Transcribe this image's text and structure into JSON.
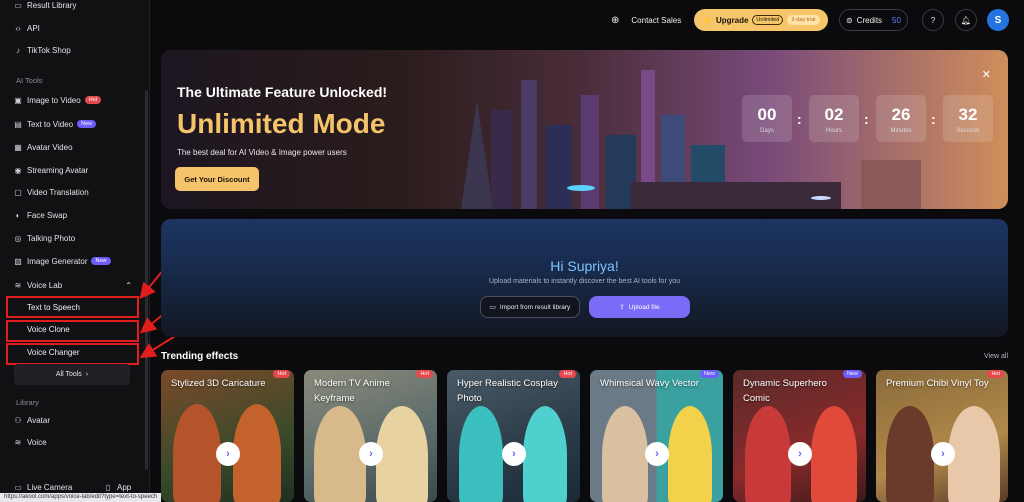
{
  "sidebar": {
    "top_items": [
      {
        "label": "Result Library",
        "icon": "folder-icon"
      },
      {
        "label": "API",
        "icon": "code-icon"
      },
      {
        "label": "TikTok Shop",
        "icon": "tiktok-icon"
      }
    ],
    "ai_tools_heading": "AI Tools",
    "ai_tools": [
      {
        "label": "Image to Video",
        "badge": "Hot"
      },
      {
        "label": "Text to Video",
        "badge": "New"
      },
      {
        "label": "Avatar Video",
        "badge": ""
      },
      {
        "label": "Streaming Avatar",
        "badge": ""
      },
      {
        "label": "Video Translation",
        "badge": ""
      },
      {
        "label": "Face Swap",
        "badge": ""
      },
      {
        "label": "Talking Photo",
        "badge": ""
      },
      {
        "label": "Image Generator",
        "badge": "New"
      }
    ],
    "voice_lab": {
      "label": "Voice Lab",
      "children": [
        "Text to Speech",
        "Voice Clone",
        "Voice Changer"
      ]
    },
    "all_tools_label": "All Tools",
    "library_heading": "Library",
    "library_items": [
      "Avatar",
      "Voice"
    ],
    "bottom": {
      "live_camera": "Live Camera",
      "app": "App"
    }
  },
  "status_url": "https://akool.com/apps/voice-lab/edit?type=text-to-speech",
  "topbar": {
    "contact_sales": "Contact Sales",
    "upgrade": {
      "label": "Upgrade",
      "pill": "Unlimited",
      "trial": "3-day trial"
    },
    "credits": {
      "label": "Credits",
      "value": "50"
    },
    "help": "?",
    "avatar_letter": "S"
  },
  "banner": {
    "title": "The Ultimate Feature Unlocked!",
    "headline": "Unlimited Mode",
    "subtitle": "The best deal for AI Video & Image power users",
    "cta": "Get Your Discount",
    "countdown": [
      {
        "value": "00",
        "label": "Days"
      },
      {
        "value": "02",
        "label": "Hours"
      },
      {
        "value": "26",
        "label": "Minutes"
      },
      {
        "value": "32",
        "label": "Seconds"
      }
    ]
  },
  "hero": {
    "greeting": "Hi Supriya!",
    "subtitle": "Upload materials to instantly discover the best AI tools for you",
    "import_label": "Import from result library",
    "upload_label": "Upload file"
  },
  "trending": {
    "title": "Trending effects",
    "view_all": "View all",
    "cards": [
      {
        "title": "Stylized 3D Caricature",
        "badge": "Hot"
      },
      {
        "title": "Modern TV Anime Keyframe",
        "badge": "Hot"
      },
      {
        "title": "Hyper Realistic Cosplay Photo",
        "badge": "Hot"
      },
      {
        "title": "Whimsical Wavy Vector",
        "badge": "New"
      },
      {
        "title": "Dynamic Superhero Comic",
        "badge": "New"
      },
      {
        "title": "Premium Chibi Vinyl Toy",
        "badge": "Hot"
      }
    ]
  },
  "colors": {
    "accent": "#7a6cf6",
    "gold": "#f5c36a",
    "hot": "#e5484d",
    "new": "#6d5dfc",
    "annotation_red": "#e01e1e"
  }
}
